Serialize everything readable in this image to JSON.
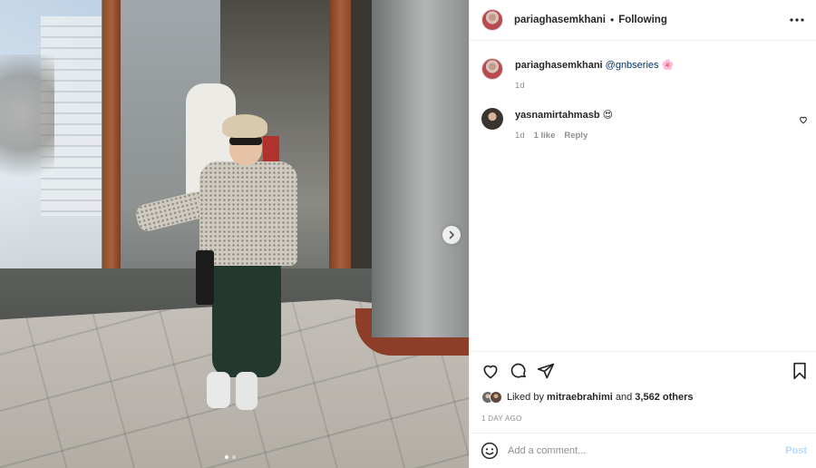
{
  "post": {
    "author": {
      "username": "pariaghasemkhani",
      "separator": "•",
      "follow_status": "Following"
    },
    "caption": {
      "username": "pariaghasemkhani",
      "mention": "@gnbseries",
      "emoji": "🌸",
      "time": "1d"
    },
    "comments": [
      {
        "username": "yasnamirtahmasb",
        "emoji": "😍",
        "time": "1d",
        "likes": "1 like",
        "reply_label": "Reply"
      }
    ],
    "likes": {
      "liked_by_prefix": "Liked by",
      "liked_by_user": "mitraebrahimi",
      "and": "and",
      "others": "3,562 others"
    },
    "date": "1 DAY AGO",
    "add_comment": {
      "placeholder": "Add a comment...",
      "post_label": "Post"
    },
    "carousel": {
      "slide_count": 2,
      "active_index": 0
    },
    "icons": {
      "more": "more-options-icon",
      "like": "heart-icon",
      "comment": "comment-icon",
      "share": "share-icon",
      "save": "bookmark-icon",
      "emoji": "emoji-icon",
      "next": "chevron-right-icon"
    },
    "colors": {
      "link": "#00376b",
      "post_button_disabled": "#b3dbff",
      "meta_text": "#8e8e8e"
    }
  }
}
